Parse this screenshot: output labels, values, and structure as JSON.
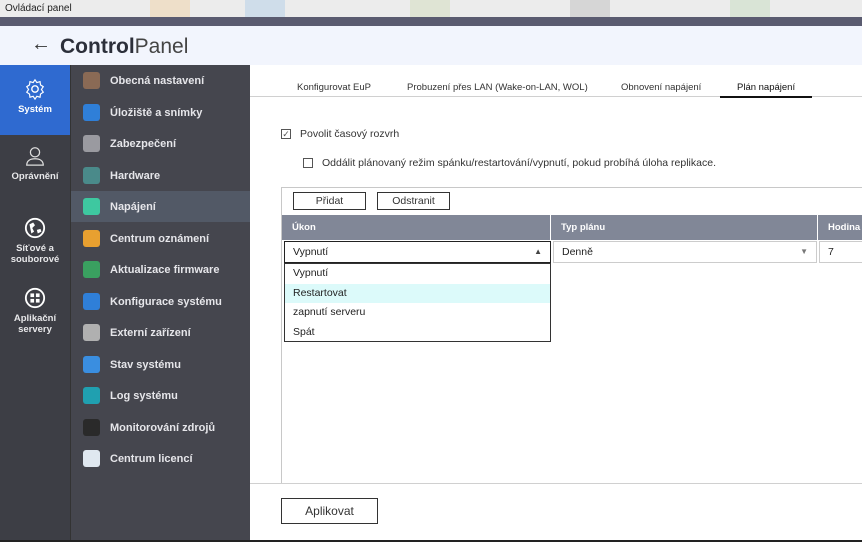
{
  "window": {
    "title": "Ovládací panel"
  },
  "header": {
    "back_icon": "arrow-left-icon",
    "brand_bold": "Control",
    "brand_light": "Panel"
  },
  "rail": [
    {
      "label": "Systém",
      "icon": "gear-icon",
      "active": true
    },
    {
      "label": "Oprávnění",
      "icon": "user-icon"
    },
    {
      "label": "Síťové a souborové",
      "icon": "globe-icon"
    },
    {
      "label": "Aplikační servery",
      "icon": "apps-grid-icon"
    }
  ],
  "submenu": [
    {
      "label": "Obecná nastavení",
      "color": "#8a6a55"
    },
    {
      "label": "Úložiště a snímky",
      "color": "#2f7fd8"
    },
    {
      "label": "Zabezpečení",
      "color": "#9a9aa0"
    },
    {
      "label": "Hardware",
      "color": "#4a8a8a"
    },
    {
      "label": "Napájení",
      "color": "#3ec8a0",
      "active": true
    },
    {
      "label": "Centrum oznámení",
      "color": "#e8a030"
    },
    {
      "label": "Aktualizace firmware",
      "color": "#3aa060"
    },
    {
      "label": "Konfigurace systému",
      "color": "#2f7fd8"
    },
    {
      "label": "Externí zařízení",
      "color": "#b0b0b0"
    },
    {
      "label": "Stav systému",
      "color": "#3a8ee0"
    },
    {
      "label": "Log systému",
      "color": "#20a0b0"
    },
    {
      "label": "Monitorování zdrojů",
      "color": "#2a2a2a"
    },
    {
      "label": "Centrum licencí",
      "color": "#e0e8f0"
    }
  ],
  "tabs": [
    {
      "label": "Konfigurovat EuP"
    },
    {
      "label": "Probuzení přes LAN (Wake-on-LAN, WOL)"
    },
    {
      "label": "Obnovení napájení"
    },
    {
      "label": "Plán napájení",
      "active": true
    }
  ],
  "options": {
    "enable_schedule": {
      "label": "Povolit časový rozvrh",
      "checked": true
    },
    "delay_replication": {
      "label": "Oddálit plánovaný režim spánku/restartování/vypnutí, pokud probíhá úloha replikace.",
      "checked": false
    }
  },
  "table": {
    "add_label": "Přidat",
    "remove_label": "Odstranit",
    "columns": [
      "Úkon",
      "Typ plánu",
      "Hodina"
    ],
    "row": {
      "action": "Vypnutí",
      "schedule_type": "Denně",
      "hour": "7"
    },
    "dropdown_options": [
      "Vypnutí",
      "Restartovat",
      "zapnutí serveru",
      "Spát"
    ],
    "hovered_option": "Restartovat"
  },
  "footer": {
    "apply_label": "Aplikovat"
  },
  "colors": {
    "accent": "#2f6ad0",
    "rail": "#3d3e45",
    "submenu": "#45464e",
    "table_header": "#818797"
  }
}
